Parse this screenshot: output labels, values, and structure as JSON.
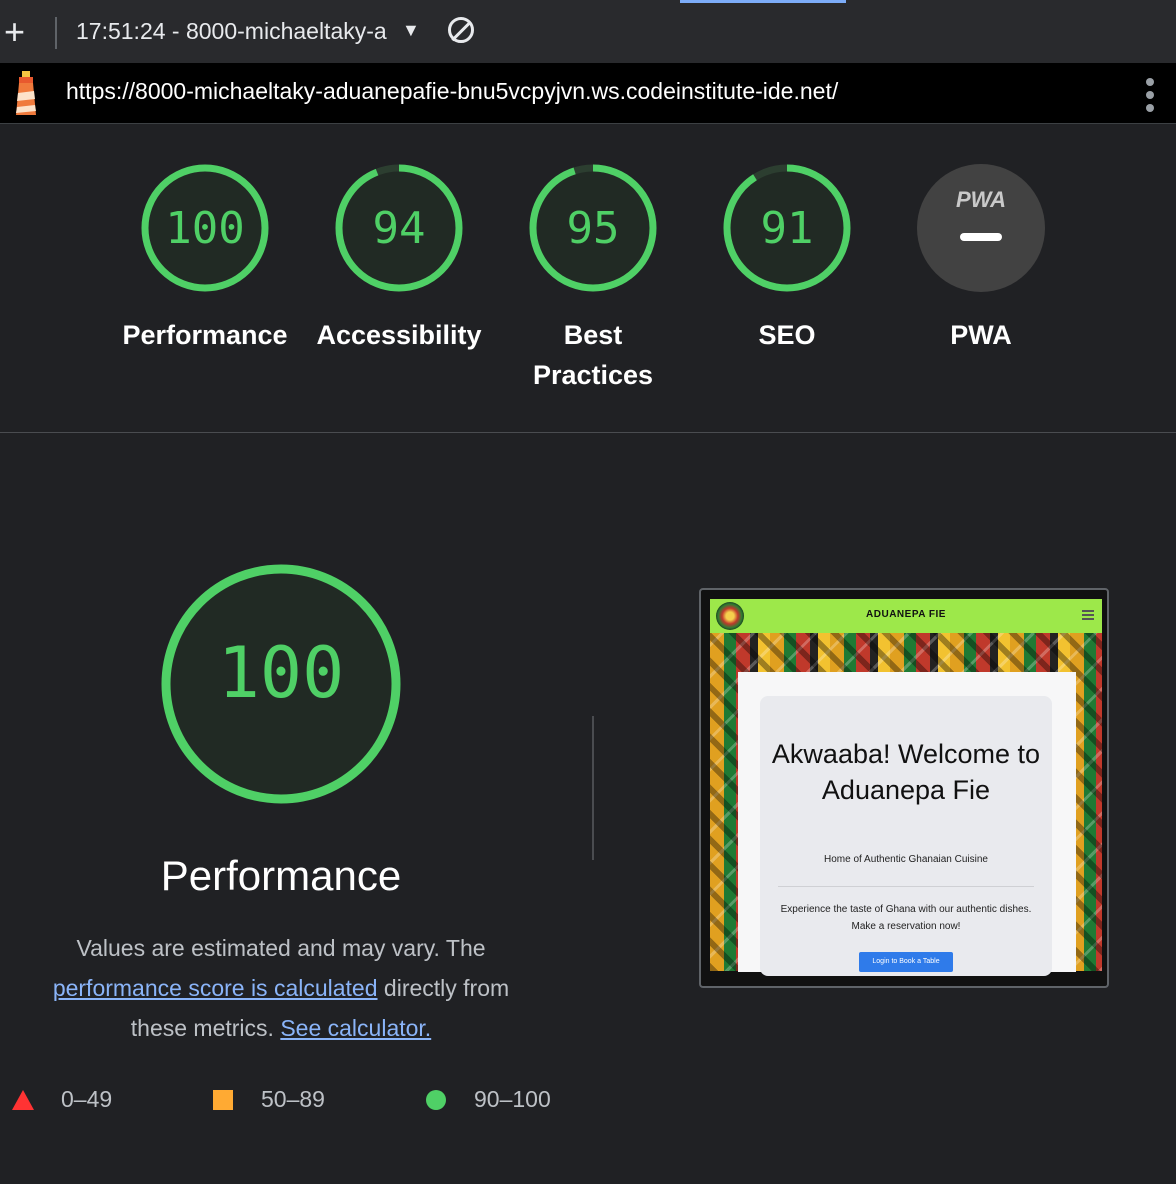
{
  "toolbar": {
    "new_report_label": "+",
    "report_selector": "17:51:24 - 8000-michaeltaky-a",
    "dropdown_glyph": "▼",
    "clear_icon": "clear-icon"
  },
  "urlbar": {
    "url": "https://8000-michaeltaky-aduanepafie-bnu5vcpyjvn.ws.codeinstitute-ide.net/"
  },
  "scores": [
    {
      "value": "100",
      "label": "Performance",
      "fraction": 1.0
    },
    {
      "value": "94",
      "label": "Accessibility",
      "fraction": 0.94
    },
    {
      "value": "95",
      "label": "Best Practices",
      "fraction": 0.95
    },
    {
      "value": "91",
      "label": "SEO",
      "fraction": 0.91
    }
  ],
  "pwa": {
    "badge": "PWA",
    "label": "PWA"
  },
  "performance": {
    "score": "100",
    "title": "Performance",
    "desc_text1": "Values are estimated and may vary. The",
    "desc_link1": "performance score is calculated",
    "desc_text2": "directly from these metrics.",
    "desc_link2": "See calculator."
  },
  "legend": [
    {
      "range": "0–49",
      "color": "#ff3333"
    },
    {
      "range": "50–89",
      "color": "#ffaa33"
    },
    {
      "range": "90–100",
      "color": "#4fd066"
    }
  ],
  "screenshot": {
    "brand": "ADUANEPA FIE",
    "headline": "Akwaaba! Welcome to Aduanepa Fie",
    "subtitle": "Home of Authentic Ghanaian Cuisine",
    "body": "Experience the taste of Ghana with our authentic dishes. Make a reservation now!",
    "button": "Login to Book a Table"
  },
  "colors": {
    "pass": "#4fd066",
    "background": "#202124"
  }
}
